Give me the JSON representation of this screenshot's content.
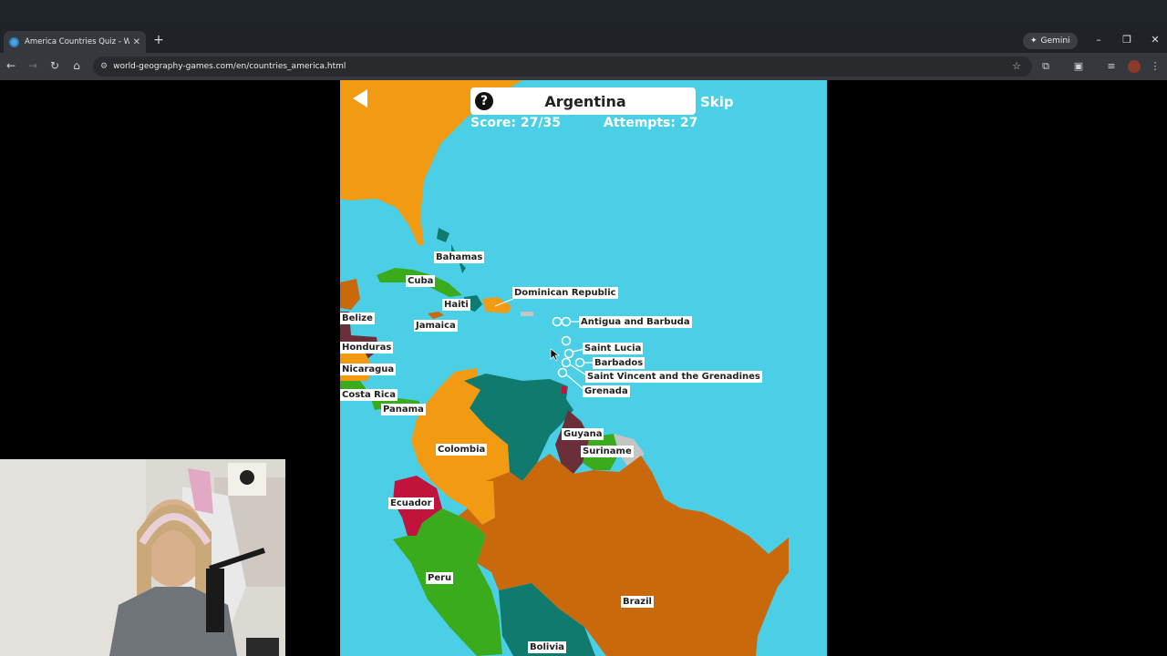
{
  "browser": {
    "tab_title": "America Countries Quiz - World",
    "new_tab_symbol": "+",
    "gemini_label": "Gemini",
    "url": "world-geography-games.com/en/countries_america.html"
  },
  "game": {
    "question": "Argentina",
    "help_symbol": "?",
    "skip_label": "Skip",
    "score": "Score: 27/35",
    "attempts": "Attempts: 27"
  },
  "labels": {
    "bahamas": "Bahamas",
    "cuba": "Cuba",
    "haiti": "Haiti",
    "dominican_republic": "Dominican Republic",
    "jamaica": "Jamaica",
    "belize": "Belize",
    "honduras": "Honduras",
    "nicaragua": "Nicaragua",
    "costa_rica": "Costa Rica",
    "panama": "Panama",
    "antigua": "Antigua and Barbuda",
    "saint_lucia": "Saint Lucia",
    "barbados": "Barbados",
    "saint_vincent": "Saint Vincent and the Grenadines",
    "grenada": "Grenada",
    "guyana": "Guyana",
    "suriname": "Suriname",
    "colombia": "Colombia",
    "ecuador": "Ecuador",
    "peru": "Peru",
    "brazil": "Brazil",
    "bolivia": "Bolivia"
  },
  "colors": {
    "ocean": "#4acfe6",
    "orange": "#f29b12",
    "dark_orange": "#c9690c",
    "teal": "#117a6f",
    "green": "#3aab1c",
    "maroon": "#6b2f3a",
    "crimson": "#c0143c",
    "grey": "#c4c4c4"
  }
}
